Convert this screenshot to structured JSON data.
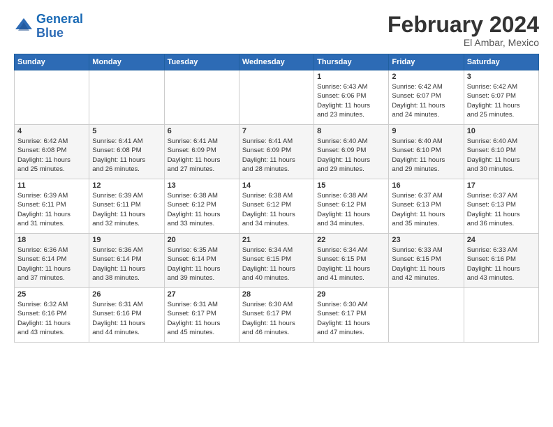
{
  "logo": {
    "line1": "General",
    "line2": "Blue"
  },
  "title": "February 2024",
  "location": "El Ambar, Mexico",
  "weekdays": [
    "Sunday",
    "Monday",
    "Tuesday",
    "Wednesday",
    "Thursday",
    "Friday",
    "Saturday"
  ],
  "weeks": [
    [
      {
        "day": "",
        "info": ""
      },
      {
        "day": "",
        "info": ""
      },
      {
        "day": "",
        "info": ""
      },
      {
        "day": "",
        "info": ""
      },
      {
        "day": "1",
        "info": "Sunrise: 6:43 AM\nSunset: 6:06 PM\nDaylight: 11 hours\nand 23 minutes."
      },
      {
        "day": "2",
        "info": "Sunrise: 6:42 AM\nSunset: 6:07 PM\nDaylight: 11 hours\nand 24 minutes."
      },
      {
        "day": "3",
        "info": "Sunrise: 6:42 AM\nSunset: 6:07 PM\nDaylight: 11 hours\nand 25 minutes."
      }
    ],
    [
      {
        "day": "4",
        "info": "Sunrise: 6:42 AM\nSunset: 6:08 PM\nDaylight: 11 hours\nand 25 minutes."
      },
      {
        "day": "5",
        "info": "Sunrise: 6:41 AM\nSunset: 6:08 PM\nDaylight: 11 hours\nand 26 minutes."
      },
      {
        "day": "6",
        "info": "Sunrise: 6:41 AM\nSunset: 6:09 PM\nDaylight: 11 hours\nand 27 minutes."
      },
      {
        "day": "7",
        "info": "Sunrise: 6:41 AM\nSunset: 6:09 PM\nDaylight: 11 hours\nand 28 minutes."
      },
      {
        "day": "8",
        "info": "Sunrise: 6:40 AM\nSunset: 6:09 PM\nDaylight: 11 hours\nand 29 minutes."
      },
      {
        "day": "9",
        "info": "Sunrise: 6:40 AM\nSunset: 6:10 PM\nDaylight: 11 hours\nand 29 minutes."
      },
      {
        "day": "10",
        "info": "Sunrise: 6:40 AM\nSunset: 6:10 PM\nDaylight: 11 hours\nand 30 minutes."
      }
    ],
    [
      {
        "day": "11",
        "info": "Sunrise: 6:39 AM\nSunset: 6:11 PM\nDaylight: 11 hours\nand 31 minutes."
      },
      {
        "day": "12",
        "info": "Sunrise: 6:39 AM\nSunset: 6:11 PM\nDaylight: 11 hours\nand 32 minutes."
      },
      {
        "day": "13",
        "info": "Sunrise: 6:38 AM\nSunset: 6:12 PM\nDaylight: 11 hours\nand 33 minutes."
      },
      {
        "day": "14",
        "info": "Sunrise: 6:38 AM\nSunset: 6:12 PM\nDaylight: 11 hours\nand 34 minutes."
      },
      {
        "day": "15",
        "info": "Sunrise: 6:38 AM\nSunset: 6:12 PM\nDaylight: 11 hours\nand 34 minutes."
      },
      {
        "day": "16",
        "info": "Sunrise: 6:37 AM\nSunset: 6:13 PM\nDaylight: 11 hours\nand 35 minutes."
      },
      {
        "day": "17",
        "info": "Sunrise: 6:37 AM\nSunset: 6:13 PM\nDaylight: 11 hours\nand 36 minutes."
      }
    ],
    [
      {
        "day": "18",
        "info": "Sunrise: 6:36 AM\nSunset: 6:14 PM\nDaylight: 11 hours\nand 37 minutes."
      },
      {
        "day": "19",
        "info": "Sunrise: 6:36 AM\nSunset: 6:14 PM\nDaylight: 11 hours\nand 38 minutes."
      },
      {
        "day": "20",
        "info": "Sunrise: 6:35 AM\nSunset: 6:14 PM\nDaylight: 11 hours\nand 39 minutes."
      },
      {
        "day": "21",
        "info": "Sunrise: 6:34 AM\nSunset: 6:15 PM\nDaylight: 11 hours\nand 40 minutes."
      },
      {
        "day": "22",
        "info": "Sunrise: 6:34 AM\nSunset: 6:15 PM\nDaylight: 11 hours\nand 41 minutes."
      },
      {
        "day": "23",
        "info": "Sunrise: 6:33 AM\nSunset: 6:15 PM\nDaylight: 11 hours\nand 42 minutes."
      },
      {
        "day": "24",
        "info": "Sunrise: 6:33 AM\nSunset: 6:16 PM\nDaylight: 11 hours\nand 43 minutes."
      }
    ],
    [
      {
        "day": "25",
        "info": "Sunrise: 6:32 AM\nSunset: 6:16 PM\nDaylight: 11 hours\nand 43 minutes."
      },
      {
        "day": "26",
        "info": "Sunrise: 6:31 AM\nSunset: 6:16 PM\nDaylight: 11 hours\nand 44 minutes."
      },
      {
        "day": "27",
        "info": "Sunrise: 6:31 AM\nSunset: 6:17 PM\nDaylight: 11 hours\nand 45 minutes."
      },
      {
        "day": "28",
        "info": "Sunrise: 6:30 AM\nSunset: 6:17 PM\nDaylight: 11 hours\nand 46 minutes."
      },
      {
        "day": "29",
        "info": "Sunrise: 6:30 AM\nSunset: 6:17 PM\nDaylight: 11 hours\nand 47 minutes."
      },
      {
        "day": "",
        "info": ""
      },
      {
        "day": "",
        "info": ""
      }
    ]
  ]
}
